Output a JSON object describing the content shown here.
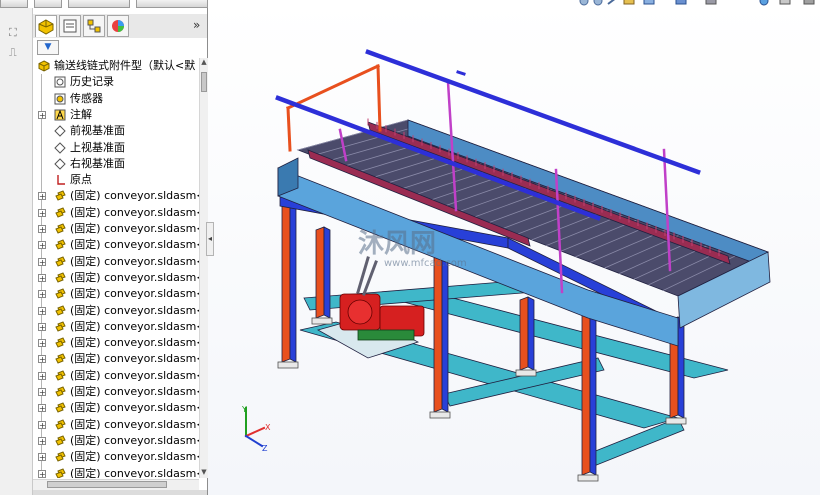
{
  "feature_tree": {
    "root_label": "输送线链式附件型（默认<默",
    "folders": [
      {
        "label": "历史记录",
        "icon": "history-icon"
      },
      {
        "label": "传感器",
        "icon": "sensor-icon"
      },
      {
        "label": "注解",
        "icon": "annotation-icon"
      },
      {
        "label": "前视基准面",
        "icon": "plane-icon"
      },
      {
        "label": "上视基准面",
        "icon": "plane-icon"
      },
      {
        "label": "右视基准面",
        "icon": "plane-icon"
      },
      {
        "label": "原点",
        "icon": "origin-icon"
      }
    ],
    "components": [
      "(固定) conveyor.sldasm<",
      "(固定) conveyor.sldasm<",
      "(固定) conveyor.sldasm<",
      "(固定) conveyor.sldasm<",
      "(固定) conveyor.sldasm<",
      "(固定) conveyor.sldasm<",
      "(固定) conveyor.sldasm<",
      "(固定) conveyor.sldasm<",
      "(固定) conveyor.sldasm<",
      "(固定) conveyor.sldasm<",
      "(固定) conveyor.sldasm<",
      "(固定) conveyor.sldasm<",
      "(固定) conveyor.sldasm<",
      "(固定) conveyor.sldasm<",
      "(固定) conveyor.sldasm<",
      "(固定) conveyor.sldasm<",
      "(固定) conveyor.sldasm<",
      "(固定) conveyor.sldasm<"
    ],
    "collapse_glyph": "»",
    "filter_glyph": "▼"
  },
  "panel_tabs": [
    "feature-manager-icon",
    "property-manager-icon",
    "configuration-manager-icon",
    "display-manager-icon"
  ],
  "watermark": {
    "title": "沐风网",
    "url": "www.mfcad.com"
  },
  "colors": {
    "frame_orange": "#e8501e",
    "frame_blue": "#2840d8",
    "frame_cyan": "#3fb7c9",
    "conveyor_blue": "#5aa4dc",
    "belt_dark": "#4b4b6b",
    "belt_teeth": "#9a2c52",
    "guard_magenta": "#c040c8",
    "rail_blue": "#2d2fd8",
    "motor_red": "#d62020",
    "axis_x": "#e03030",
    "axis_y": "#20a020",
    "axis_z": "#2040d0"
  }
}
